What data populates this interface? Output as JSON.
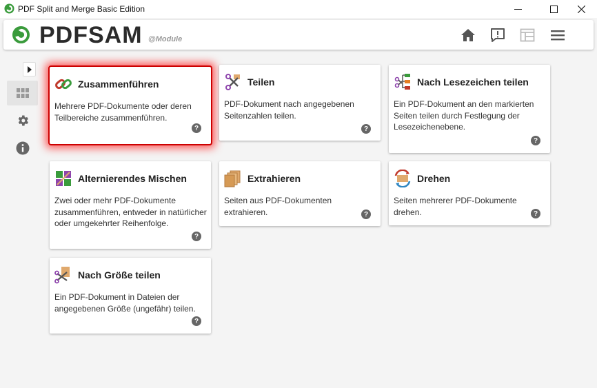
{
  "window": {
    "title": "PDF Split and Merge Basic Edition"
  },
  "header": {
    "logo_text": "PDFSAM",
    "logo_sub": "@Module"
  },
  "modules": [
    {
      "title": "Zusammenführen",
      "description": "Mehrere PDF-Dokumente oder deren Teilbereiche zusammenführen.",
      "help": "?"
    },
    {
      "title": "Teilen",
      "description": "PDF-Dokument nach angegebenen Seitenzahlen teilen.",
      "help": "?"
    },
    {
      "title": "Nach Lesezeichen teilen",
      "description": "Ein PDF-Dokument an den markierten Seiten teilen durch Festlegung der Lesezeichenebene.",
      "help": "?"
    },
    {
      "title": "Alternierendes Mischen",
      "description": "Zwei oder mehr PDF-Dokumente zusammenführen, entweder in natürlicher oder umgekehrter Reihenfolge.",
      "help": "?"
    },
    {
      "title": "Extrahieren",
      "description": "Seiten aus PDF-Dokumenten extrahieren.",
      "help": "?"
    },
    {
      "title": "Drehen",
      "description": "Seiten mehrerer PDF-Dokumente drehen.",
      "help": "?"
    },
    {
      "title": "Nach Größe teilen",
      "description": "Ein PDF-Dokument in Dateien der angegebenen Größe (ungefähr) teilen.",
      "help": "?"
    }
  ],
  "icons": {
    "home": "home-icon",
    "feedback": "feedback-icon",
    "dashboard": "dashboard-icon",
    "menu": "menu-icon",
    "modules": "grid-icon",
    "settings": "gear-icon",
    "info": "info-icon"
  },
  "colors": {
    "selection": "#cc0000",
    "logo_green": "#3a9b3c"
  }
}
